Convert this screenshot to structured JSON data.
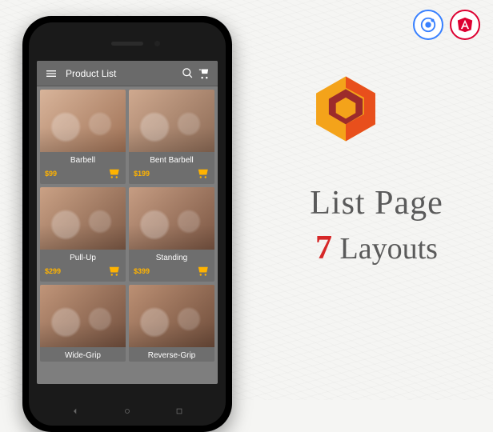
{
  "header": {
    "title": "Product List"
  },
  "products": [
    {
      "name": "Barbell",
      "price": "$99"
    },
    {
      "name": "Bent Barbell",
      "price": "$199"
    },
    {
      "name": "Pull-Up",
      "price": "$299"
    },
    {
      "name": "Standing",
      "price": "$399"
    },
    {
      "name": "Wide-Grip",
      "price": ""
    },
    {
      "name": "Reverse-Grip",
      "price": ""
    }
  ],
  "promo": {
    "line1": "List Page",
    "count": "7",
    "line2_rest": " Layouts"
  },
  "colors": {
    "accent": "#ffb300",
    "ionic": "#3880ff",
    "angular": "#dd0031",
    "promo_red": "#d62828"
  }
}
